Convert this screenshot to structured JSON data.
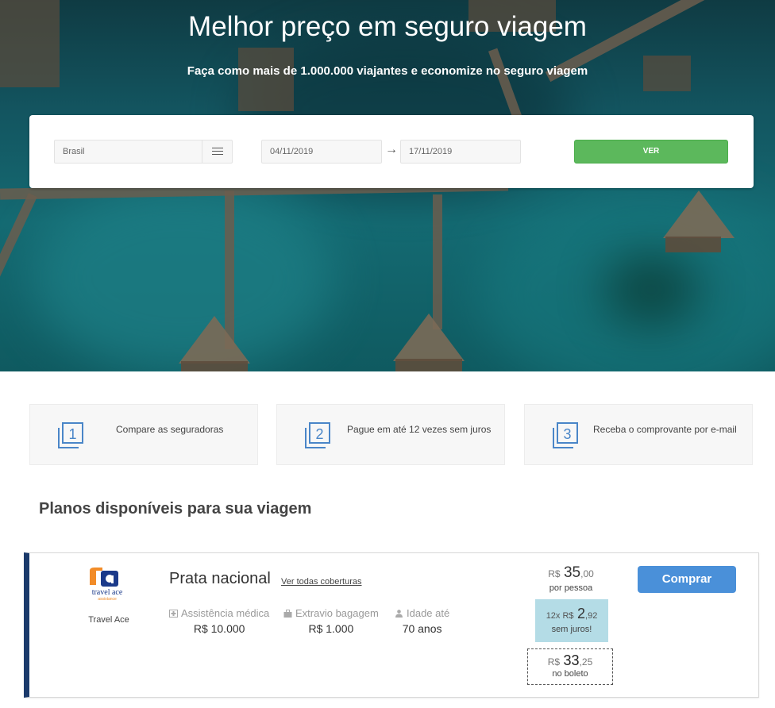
{
  "hero": {
    "title": "Melhor preço em seguro viagem",
    "subtitle": "Faça como mais de 1.000.000 viajantes e economize no seguro viagem"
  },
  "search": {
    "destination": "Brasil",
    "date_from": "04/11/2019",
    "date_to": "17/11/2019",
    "submit_label": "VER"
  },
  "steps": [
    {
      "number": "1",
      "label": "Compare as seguradoras"
    },
    {
      "number": "2",
      "label": "Pague em até 12 vezes sem juros"
    },
    {
      "number": "3",
      "label": "Receba o comprovante por e-mail"
    }
  ],
  "plans_title": "Planos disponíveis para sua viagem",
  "plan": {
    "brand": "Travel Ace",
    "logo_text": "travel ace",
    "logo_subtext": "assistance",
    "name": "Prata nacional",
    "coverage_link": "Ver todas coberturas",
    "features": [
      {
        "icon": "medical-cross-icon",
        "label": "Assistência médica",
        "value": "R$ 10.000"
      },
      {
        "icon": "luggage-icon",
        "label": "Extravio bagagem",
        "value": "R$ 1.000"
      },
      {
        "icon": "person-icon",
        "label": "Idade até",
        "value": "70 anos"
      }
    ],
    "price": {
      "currency": "R$",
      "amount": "35",
      "cents": ",00",
      "note": "por pessoa"
    },
    "installment": {
      "prefix": "12x R$",
      "amount": "2",
      "cents": ",92",
      "note": "sem juros!"
    },
    "boleto": {
      "currency": "R$",
      "amount": "33",
      "cents": ",25",
      "note": "no boleto"
    },
    "buy_label": "Comprar"
  },
  "colors": {
    "accent_green": "#5cb85c",
    "accent_blue": "#4a90d9",
    "card_border_navy": "#1b3a6b",
    "installment_bg": "#b4dce6",
    "step_icon_blue": "#4a86c8"
  }
}
